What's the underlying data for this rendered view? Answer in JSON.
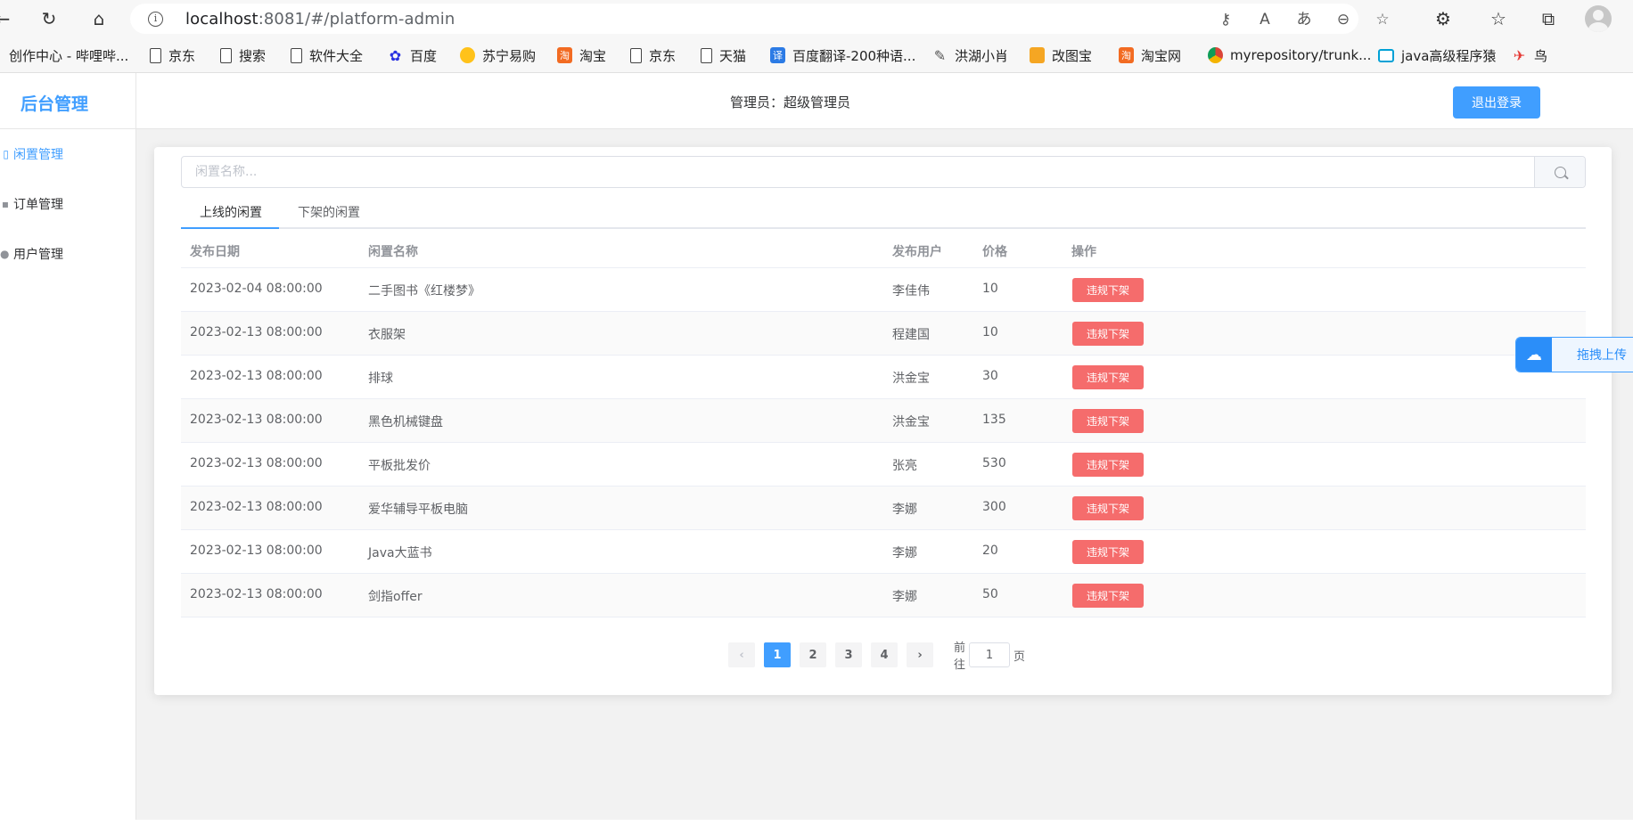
{
  "browser": {
    "url_host": "localhost",
    "url_rest": ":8081/#/platform-admin",
    "bookmarks": [
      {
        "label": "创作中心 - 哔哩哔...",
        "icon": "bilibili-icon"
      },
      {
        "label": "京东",
        "icon": "page-icon"
      },
      {
        "label": "搜索",
        "icon": "page-icon"
      },
      {
        "label": "软件大全",
        "icon": "page-icon"
      },
      {
        "label": "百度",
        "icon": "baidu-icon"
      },
      {
        "label": "苏宁易购",
        "icon": "suning-icon"
      },
      {
        "label": "淘宝",
        "icon": "taobao-icon"
      },
      {
        "label": "京东",
        "icon": "page-icon"
      },
      {
        "label": "天猫",
        "icon": "page-icon"
      },
      {
        "label": "百度翻译-200种语...",
        "icon": "fanyi-icon"
      },
      {
        "label": "洪湖小肖",
        "icon": "hong-icon"
      },
      {
        "label": "改图宝",
        "icon": "gaitu-icon"
      },
      {
        "label": "淘宝网",
        "icon": "taobao-icon"
      },
      {
        "label": "myrepository/trunk...",
        "icon": "chrome-icon"
      },
      {
        "label": "java高级程序猿",
        "icon": "tv-icon"
      },
      {
        "label": "鸟",
        "icon": "bird-icon"
      }
    ]
  },
  "header": {
    "logo": "后台管理",
    "admin": "管理员：超级管理员",
    "logout": "退出登录"
  },
  "sidebar": {
    "items": [
      {
        "label": "闲置管理",
        "active": true
      },
      {
        "label": "订单管理",
        "active": false
      },
      {
        "label": "用户管理",
        "active": false
      }
    ]
  },
  "search": {
    "placeholder": "闲置名称..."
  },
  "tabs": [
    {
      "label": "上线的闲置",
      "active": true
    },
    {
      "label": "下架的闲置",
      "active": false
    }
  ],
  "table": {
    "columns": [
      "发布日期",
      "闲置名称",
      "发布用户",
      "价格",
      "操作"
    ],
    "action_label": "违规下架",
    "rows": [
      {
        "date": "2023-02-04 08:00:00",
        "name": "二手图书《红楼梦》",
        "user": "李佳伟",
        "price": "10"
      },
      {
        "date": "2023-02-13 08:00:00",
        "name": "衣服架",
        "user": "程建国",
        "price": "10"
      },
      {
        "date": "2023-02-13 08:00:00",
        "name": "排球",
        "user": "洪金宝",
        "price": "30"
      },
      {
        "date": "2023-02-13 08:00:00",
        "name": "黑色机械键盘",
        "user": "洪金宝",
        "price": "135"
      },
      {
        "date": "2023-02-13 08:00:00",
        "name": "平板批发价",
        "user": "张亮",
        "price": "530"
      },
      {
        "date": "2023-02-13 08:00:00",
        "name": "爱华辅导平板电脑",
        "user": "李娜",
        "price": "300"
      },
      {
        "date": "2023-02-13 08:00:00",
        "name": "Java大蓝书",
        "user": "李娜",
        "price": "20"
      },
      {
        "date": "2023-02-13 08:00:00",
        "name": "剑指offer",
        "user": "李娜",
        "price": "50"
      }
    ]
  },
  "pagination": {
    "pages": [
      "1",
      "2",
      "3",
      "4"
    ],
    "current": "1",
    "goto_prefix": "前往",
    "goto_value": "1",
    "goto_suffix": "页"
  },
  "upload_widget": {
    "label": "拖拽上传"
  },
  "colors": {
    "primary": "#409eff",
    "danger": "#f56c6c"
  }
}
